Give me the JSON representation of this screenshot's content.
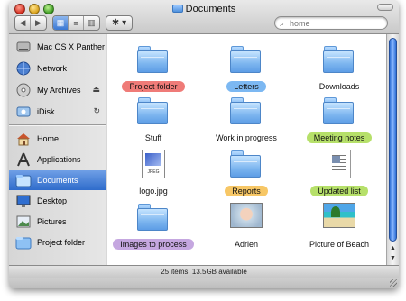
{
  "window": {
    "title": "Documents"
  },
  "toolbar": {
    "back_label": "◀",
    "forward_label": "▶",
    "view_icon_label": "▦",
    "view_list_label": "≡",
    "view_column_label": "▥",
    "action_label": "✱ ▾",
    "search_placeholder": "home"
  },
  "sidebar": {
    "devices": [
      {
        "label": "Mac OS X Panther",
        "icon": "hard-disk-icon"
      },
      {
        "label": "Network",
        "icon": "network-globe-icon"
      },
      {
        "label": "My Archives",
        "icon": "disk-icon",
        "trail": "⏏"
      },
      {
        "label": "iDisk",
        "icon": "idisk-icon",
        "trail": "↻"
      }
    ],
    "places": [
      {
        "label": "Home",
        "icon": "home-icon"
      },
      {
        "label": "Applications",
        "icon": "applications-icon"
      },
      {
        "label": "Documents",
        "icon": "documents-folder-icon",
        "selected": true
      },
      {
        "label": "Desktop",
        "icon": "desktop-icon"
      },
      {
        "label": "Pictures",
        "icon": "pictures-icon"
      },
      {
        "label": "Project folder",
        "icon": "project-folder-icon"
      }
    ]
  },
  "content": {
    "items": [
      {
        "label": "Project folder",
        "kind": "folder",
        "tag_color": "#ef7b78"
      },
      {
        "label": "Letters",
        "kind": "folder",
        "tag_color": "#7cb8f2"
      },
      {
        "label": "Downloads",
        "kind": "folder",
        "tag_color": ""
      },
      {
        "label": "Stuff",
        "kind": "folder",
        "tag_color": ""
      },
      {
        "label": "Work in progress",
        "kind": "folder",
        "tag_color": ""
      },
      {
        "label": "Meeting notes",
        "kind": "folder",
        "tag_color": "#b6e06a"
      },
      {
        "label": "logo.jpg",
        "kind": "jpeg",
        "tag_color": ""
      },
      {
        "label": "Reports",
        "kind": "folder",
        "tag_color": "#f7c766"
      },
      {
        "label": "Updated list",
        "kind": "document",
        "tag_color": "#b6e06a"
      },
      {
        "label": "Images to process",
        "kind": "folder",
        "tag_color": "#c5a7e0"
      },
      {
        "label": "Adrien",
        "kind": "photo-baby",
        "tag_color": ""
      },
      {
        "label": "Picture of Beach",
        "kind": "photo-beach",
        "tag_color": ""
      }
    ],
    "jpeg_tag": "JPEG"
  },
  "status": {
    "text": "25 items, 13.5GB available"
  }
}
